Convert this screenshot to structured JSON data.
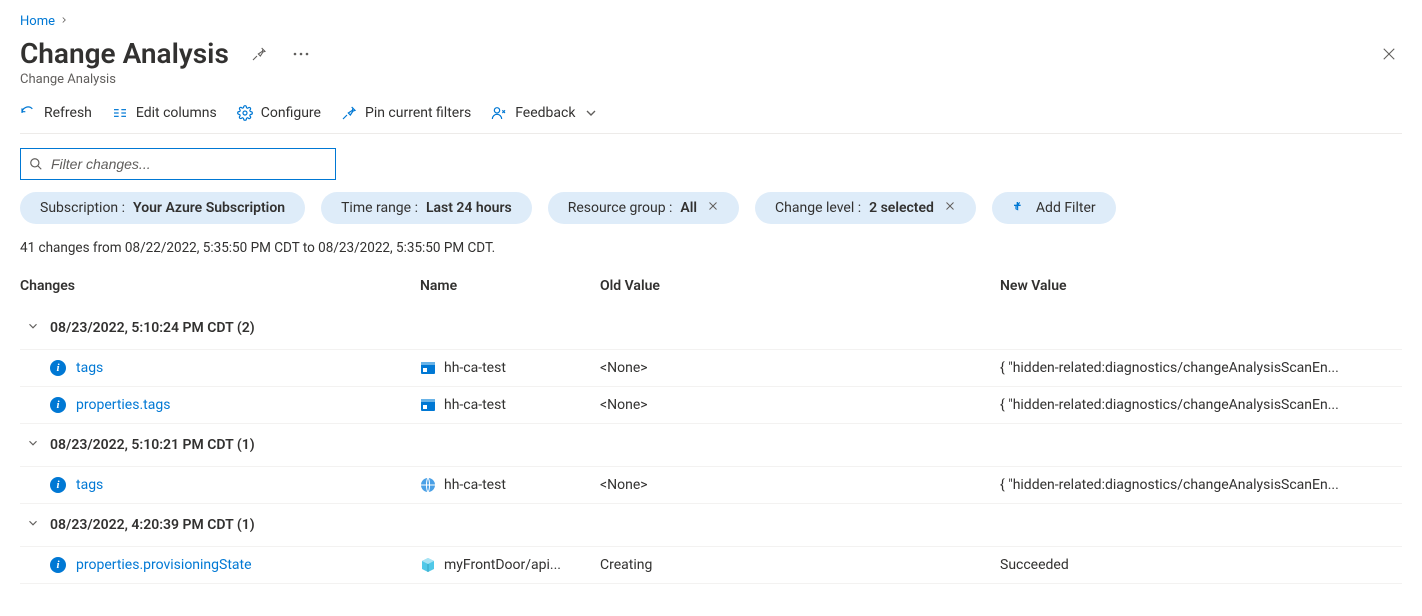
{
  "breadcrumb": {
    "home": "Home"
  },
  "header": {
    "title": "Change Analysis",
    "subtitle": "Change Analysis"
  },
  "toolbar": {
    "refresh": "Refresh",
    "edit_columns": "Edit columns",
    "configure": "Configure",
    "pin": "Pin current filters",
    "feedback": "Feedback"
  },
  "filter": {
    "placeholder": "Filter changes..."
  },
  "pills": {
    "subscription_label": "Subscription : ",
    "subscription_value": "Your Azure Subscription",
    "timerange_label": "Time range : ",
    "timerange_value": "Last 24 hours",
    "rg_label": "Resource group : ",
    "rg_value": "All",
    "level_label": "Change level : ",
    "level_value": "2 selected",
    "add_filter": "Add Filter"
  },
  "summary": "41 changes from 08/22/2022, 5:35:50 PM CDT to 08/23/2022, 5:35:50 PM CDT.",
  "columns": {
    "changes": "Changes",
    "name": "Name",
    "old": "Old Value",
    "new": "New Value"
  },
  "groups": [
    {
      "label": "08/23/2022, 5:10:24 PM CDT (2)",
      "rows": [
        {
          "change": "tags",
          "name": "hh-ca-test",
          "icon": "storage",
          "old": "<None>",
          "new": "{ \"hidden-related:diagnostics/changeAnalysisScanEn..."
        },
        {
          "change": "properties.tags",
          "name": "hh-ca-test",
          "icon": "storage",
          "old": "<None>",
          "new": "{ \"hidden-related:diagnostics/changeAnalysisScanEn..."
        }
      ]
    },
    {
      "label": "08/23/2022, 5:10:21 PM CDT (1)",
      "rows": [
        {
          "change": "tags",
          "name": "hh-ca-test",
          "icon": "globe",
          "old": "<None>",
          "new": "{ \"hidden-related:diagnostics/changeAnalysisScanEn..."
        }
      ]
    },
    {
      "label": "08/23/2022, 4:20:39 PM CDT (1)",
      "rows": [
        {
          "change": "properties.provisioningState",
          "name": "myFrontDoor/api...",
          "icon": "cube",
          "old": "Creating",
          "new": "Succeeded"
        }
      ]
    }
  ]
}
